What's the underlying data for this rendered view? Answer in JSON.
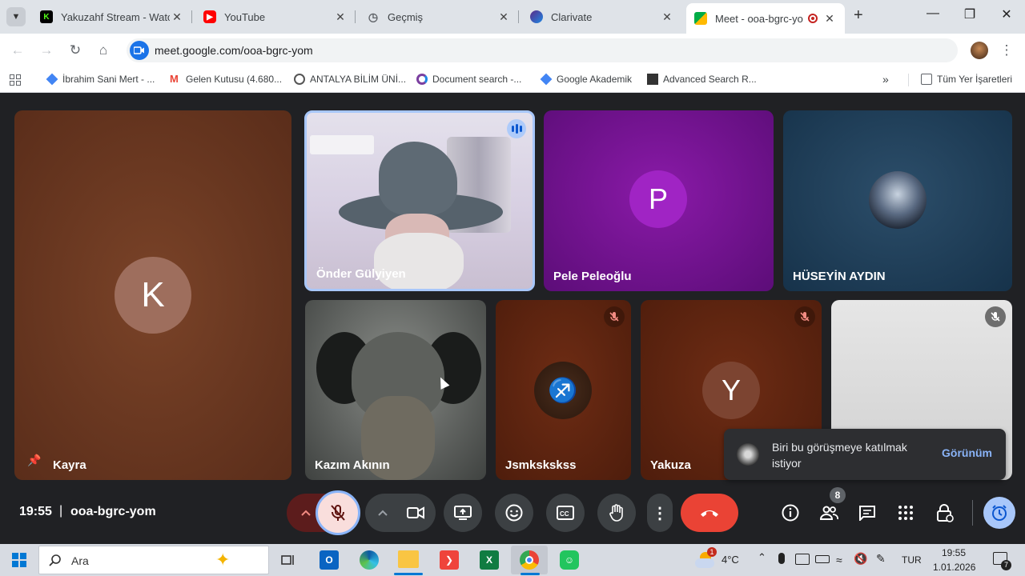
{
  "browser": {
    "tabs": [
      {
        "title": "Yakuzahf Stream - Watch",
        "icon": "kick-icon",
        "color": "#53fc18"
      },
      {
        "title": "YouTube",
        "icon": "youtube-icon",
        "color": "#ff0000"
      },
      {
        "title": "Geçmiş",
        "icon": "history-icon",
        "color": "#5f6368"
      },
      {
        "title": "Clarivate",
        "icon": "clarivate-icon",
        "color": "#5b2a86"
      },
      {
        "title": "Meet - ooa-bgrc-yom",
        "icon": "meet-icon",
        "color": "#00897b"
      }
    ],
    "url": "meet.google.com/ooa-bgrc-yom",
    "bookmarks": [
      {
        "label": "İbrahim Sani Mert - ...",
        "icon": "scholar-icon"
      },
      {
        "label": "Gelen Kutusu (4.680...",
        "icon": "gmail-icon"
      },
      {
        "label": "ANTALYA BİLİM ÜNİ...",
        "icon": "university-icon"
      },
      {
        "label": "Document search -...",
        "icon": "clarivate-icon"
      },
      {
        "label": "Google Akademik",
        "icon": "scholar-icon"
      },
      {
        "label": "Advanced Search R...",
        "icon": "ieee-icon"
      }
    ],
    "bookmarks_folder": "Tüm Yer İşaretleri"
  },
  "meet": {
    "participants": {
      "kayra": {
        "name": "Kayra",
        "initial": "K"
      },
      "onder": {
        "name": "Önder Gülyiyen"
      },
      "pele": {
        "name": "Pele Peleoğlu",
        "initial": "P"
      },
      "huseyin": {
        "name": "HÜSEYİN AYDIN"
      },
      "kazim": {
        "name": "Kazım Akının"
      },
      "jsm": {
        "name": "Jsmkskskss"
      },
      "yakuza": {
        "name": "Yakuza",
        "initial": "Y"
      }
    },
    "notification": {
      "text": "Biri bu görüşmeye katılmak istiyor",
      "action": "Görünüm"
    },
    "time": "19:55",
    "separator": "|",
    "meeting_code": "ooa-bgrc-yom",
    "people_count": "8"
  },
  "taskbar": {
    "search_placeholder": "Ara",
    "weather": "4°C",
    "language": "TUR",
    "clock_time": "19:55",
    "clock_date": "1.01.2026",
    "notif_count": "7",
    "weather_badge": "1"
  },
  "colors": {
    "tab_bg": "#dfe3e8",
    "meet_bg": "#202124",
    "end_call": "#ea4335",
    "accent_blue": "#8ab4f8",
    "mic_off_bg": "#f9dedc"
  }
}
